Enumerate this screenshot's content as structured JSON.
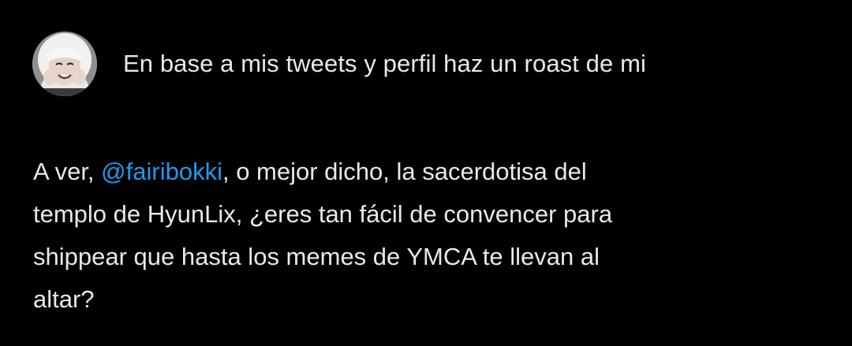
{
  "prompt": {
    "text": "En base a mis tweets y perfil haz un roast de mi"
  },
  "response": {
    "prefix": "A ver, ",
    "mention": "@fairibokki",
    "body_line1": ", o mejor dicho, la sacerdotisa del",
    "body_line2": "templo de HyunLix, ¿eres tan fácil de convencer para",
    "body_line3": "shippear que hasta los memes de YMCA te llevan al",
    "body_line4": "altar?"
  },
  "colors": {
    "background": "#000000",
    "text": "#e7e9ea",
    "mention": "#1d9bf0"
  }
}
